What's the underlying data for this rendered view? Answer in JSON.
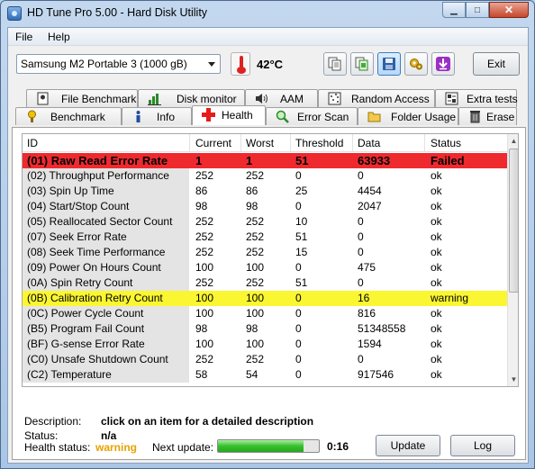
{
  "window": {
    "title": "HD Tune Pro 5.00 - Hard Disk Utility"
  },
  "menu": {
    "file": "File",
    "help": "Help"
  },
  "toolbar": {
    "drive": "Samsung M2 Portable 3 (1000 gB)",
    "temperature": "42°C",
    "exit_label": "Exit"
  },
  "tabs": {
    "top": [
      "File Benchmark",
      "Disk monitor",
      "AAM",
      "Random Access",
      "Extra tests"
    ],
    "bottom": [
      "Benchmark",
      "Info",
      "Health",
      "Error Scan",
      "Folder Usage",
      "Erase"
    ],
    "selected": "Health"
  },
  "table": {
    "headers": [
      "ID",
      "Current",
      "Worst",
      "Threshold",
      "Data",
      "Status"
    ],
    "rows": [
      {
        "id": "(01) Raw Read Error Rate",
        "current": "1",
        "worst": "1",
        "threshold": "51",
        "data": "63933",
        "status": "Failed",
        "state": "failed"
      },
      {
        "id": "(02) Throughput Performance",
        "current": "252",
        "worst": "252",
        "threshold": "0",
        "data": "0",
        "status": "ok",
        "state": "ok"
      },
      {
        "id": "(03) Spin Up Time",
        "current": "86",
        "worst": "86",
        "threshold": "25",
        "data": "4454",
        "status": "ok",
        "state": "ok"
      },
      {
        "id": "(04) Start/Stop Count",
        "current": "98",
        "worst": "98",
        "threshold": "0",
        "data": "2047",
        "status": "ok",
        "state": "ok"
      },
      {
        "id": "(05) Reallocated Sector Count",
        "current": "252",
        "worst": "252",
        "threshold": "10",
        "data": "0",
        "status": "ok",
        "state": "ok"
      },
      {
        "id": "(07) Seek Error Rate",
        "current": "252",
        "worst": "252",
        "threshold": "51",
        "data": "0",
        "status": "ok",
        "state": "ok"
      },
      {
        "id": "(08) Seek Time Performance",
        "current": "252",
        "worst": "252",
        "threshold": "15",
        "data": "0",
        "status": "ok",
        "state": "ok"
      },
      {
        "id": "(09) Power On Hours Count",
        "current": "100",
        "worst": "100",
        "threshold": "0",
        "data": "475",
        "status": "ok",
        "state": "ok"
      },
      {
        "id": "(0A) Spin Retry Count",
        "current": "252",
        "worst": "252",
        "threshold": "51",
        "data": "0",
        "status": "ok",
        "state": "ok"
      },
      {
        "id": "(0B) Calibration Retry Count",
        "current": "100",
        "worst": "100",
        "threshold": "0",
        "data": "16",
        "status": "warning",
        "state": "warning"
      },
      {
        "id": "(0C) Power Cycle Count",
        "current": "100",
        "worst": "100",
        "threshold": "0",
        "data": "816",
        "status": "ok",
        "state": "ok"
      },
      {
        "id": "(B5) Program Fail Count",
        "current": "98",
        "worst": "98",
        "threshold": "0",
        "data": "51348558",
        "status": "ok",
        "state": "ok"
      },
      {
        "id": "(BF) G-sense Error Rate",
        "current": "100",
        "worst": "100",
        "threshold": "0",
        "data": "1594",
        "status": "ok",
        "state": "ok"
      },
      {
        "id": "(C0) Unsafe Shutdown Count",
        "current": "252",
        "worst": "252",
        "threshold": "0",
        "data": "0",
        "status": "ok",
        "state": "ok"
      },
      {
        "id": "(C2) Temperature",
        "current": "58",
        "worst": "54",
        "threshold": "0",
        "data": "917546",
        "status": "ok",
        "state": "ok"
      }
    ]
  },
  "details": {
    "description_label": "Description:",
    "description_value": "click on an item for a detailed description",
    "status_label": "Status:",
    "status_value": "n/a"
  },
  "footer": {
    "health_status_label": "Health status:",
    "health_status_value": "warning",
    "next_update_label": "Next update:",
    "countdown": "0:16",
    "progress_fraction": 0.85,
    "update_label": "Update",
    "log_label": "Log"
  },
  "colors": {
    "failed_row": "#ee2a2f",
    "warning_row": "#fbf632",
    "warning_text": "#e8a200",
    "progress_green": "#37c02c"
  }
}
